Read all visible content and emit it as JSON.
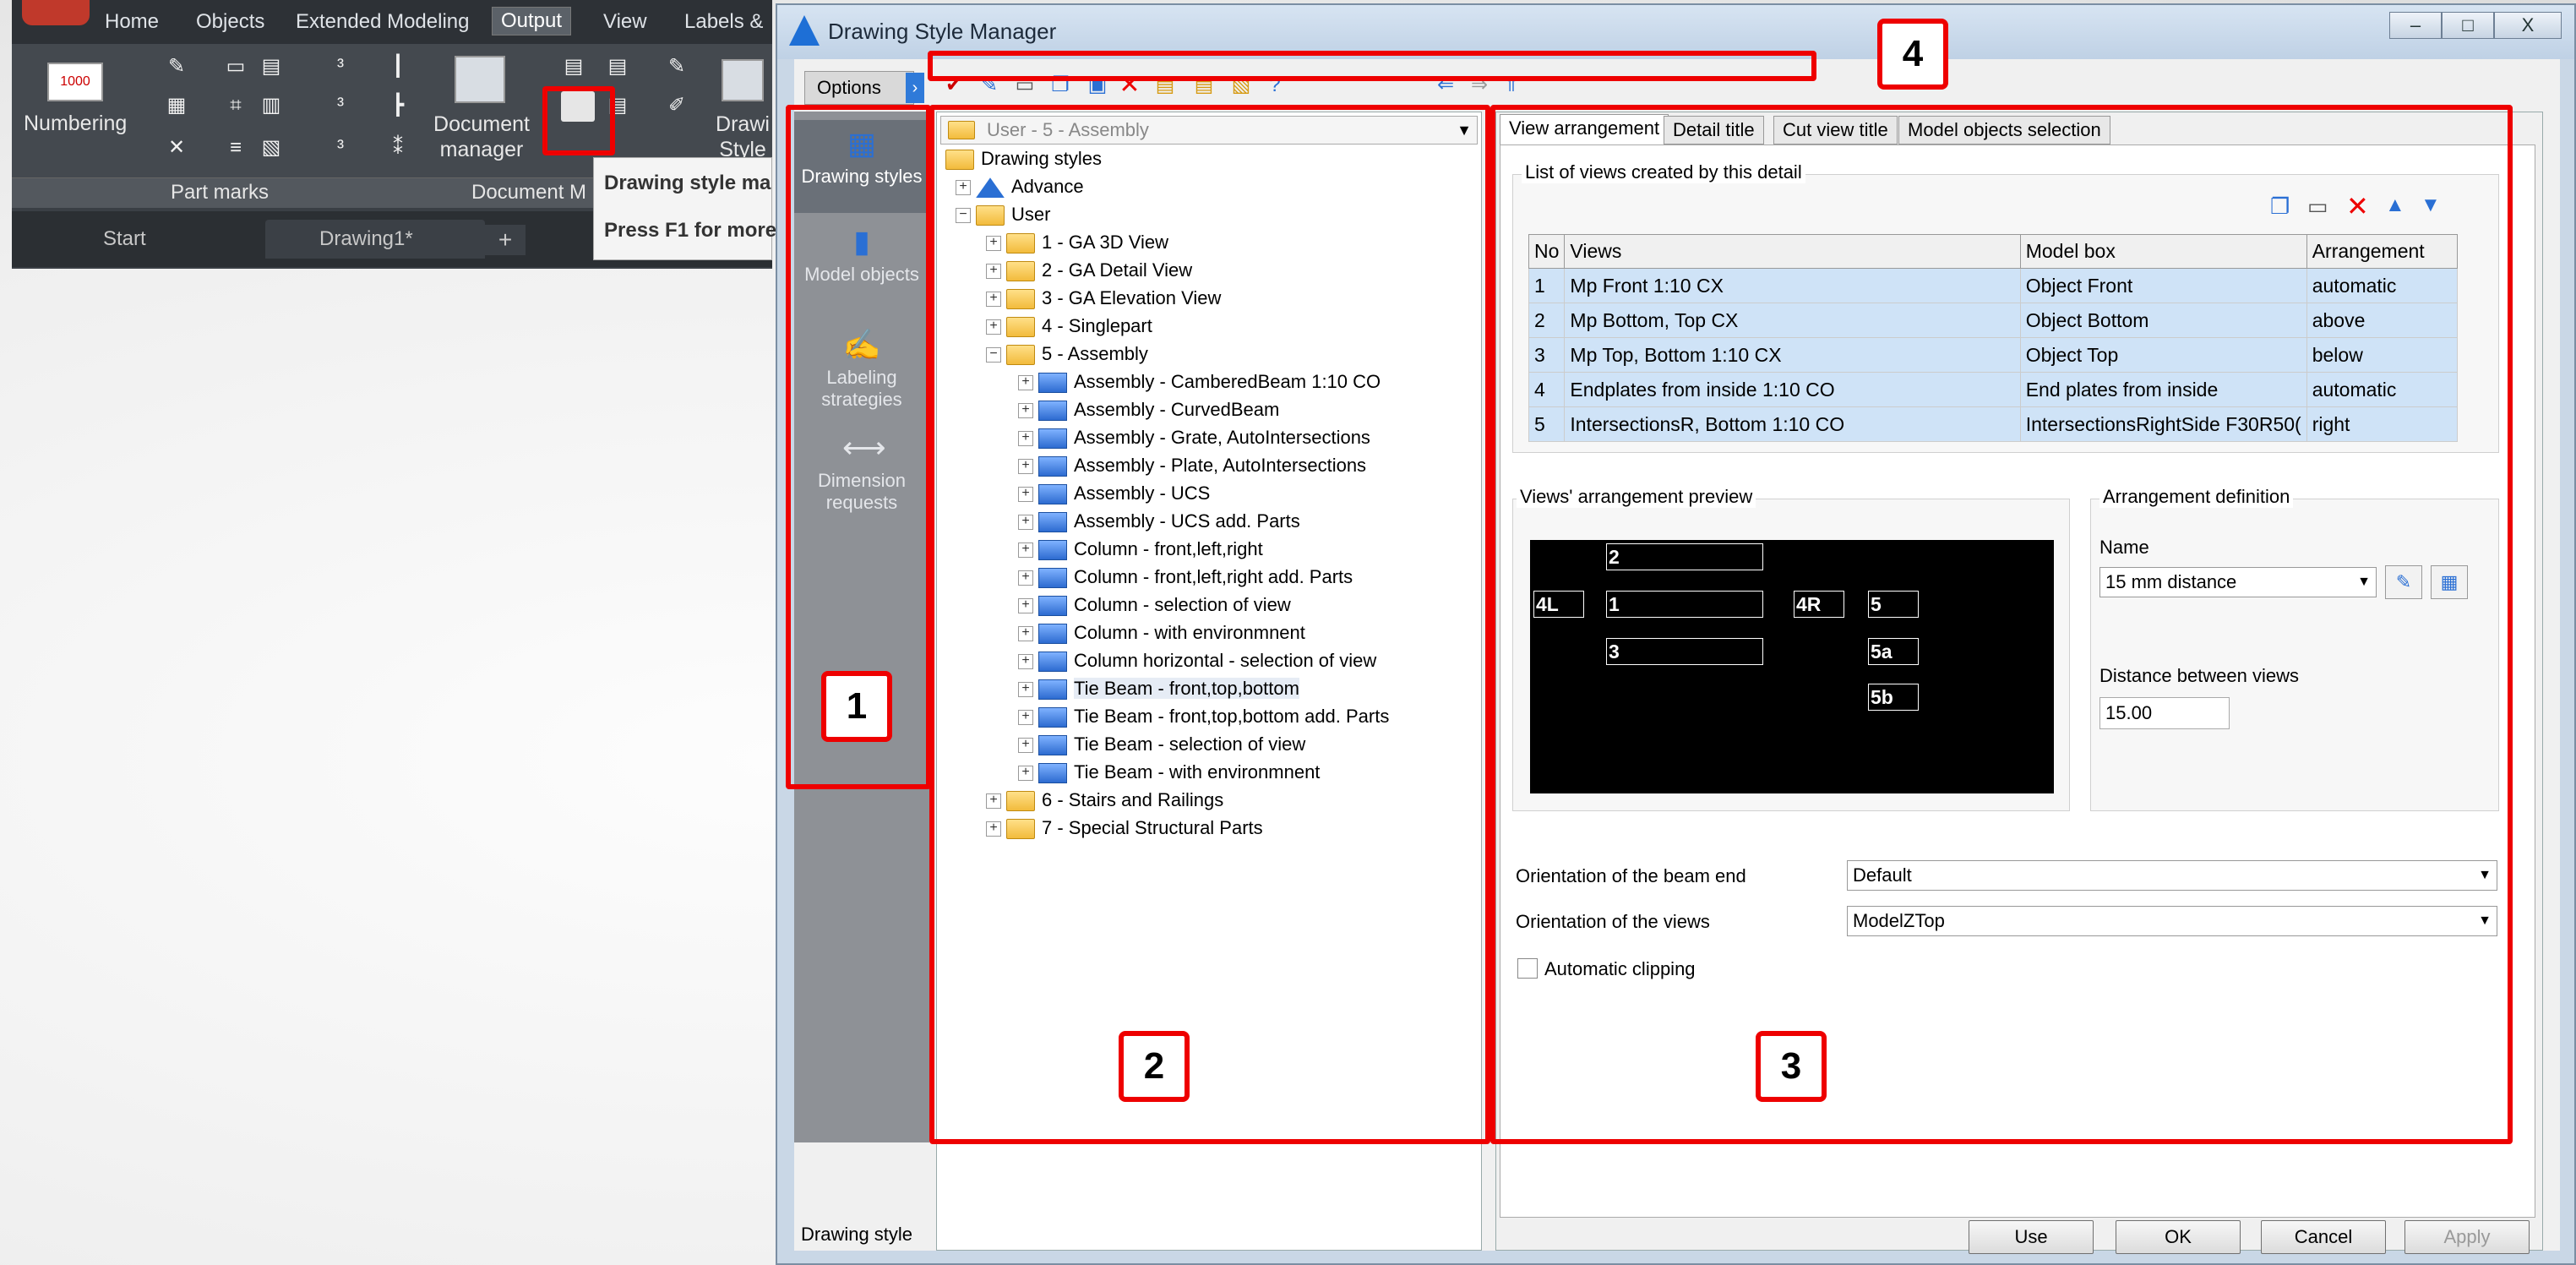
{
  "ribbon": {
    "tabs": [
      "Home",
      "Objects",
      "Extended Modeling",
      "Output",
      "View",
      "Labels &"
    ],
    "active_tab": "Output",
    "numbering_label": "Numbering",
    "doc_manager_label": "Document manager",
    "drawing_styles_label": "Drawi Style",
    "part_marks_panel": "Part marks",
    "doc_panel": "Document M",
    "doc_tabs": [
      "Start",
      "Drawing1*"
    ],
    "add_tab": "+",
    "tooltip_title": "Drawing style ma",
    "tooltip_help": "Press F1 for more"
  },
  "dialog": {
    "title": "Drawing Style Manager",
    "minimize": "–",
    "maximize": "□",
    "close": "X",
    "options_tab": "Options",
    "sidebar": [
      {
        "label": "Drawing styles",
        "icon": "drawing-styles-icon"
      },
      {
        "label": "Model objects",
        "icon": "model-objects-icon"
      },
      {
        "label": "Labeling strategies",
        "icon": "labeling-icon"
      },
      {
        "label": "Dimension requests",
        "icon": "dimension-icon"
      }
    ],
    "tree_combo": "User - 5 - Assembly",
    "tree": {
      "root": "Drawing styles",
      "advance": "Advance",
      "user": "User",
      "groups": [
        "1 - GA 3D View",
        "2 - GA Detail View",
        "3 - GA Elevation View",
        "4 - Singlepart",
        "5 - Assembly"
      ],
      "assembly_children": [
        "Assembly - CamberedBeam 1:10 CO",
        "Assembly - CurvedBeam",
        "Assembly - Grate, AutoIntersections",
        "Assembly - Plate, AutoIntersections",
        "Assembly - UCS",
        "Assembly - UCS add. Parts",
        "Column - front,left,right",
        "Column - front,left,right add. Parts",
        "Column - selection of view",
        "Column - with environmnent",
        "Column horizontal - selection of view",
        "Tie Beam - front,top,bottom",
        "Tie Beam - front,top,bottom add. Parts",
        "Tie Beam - selection of view",
        "Tie Beam - with environmnent"
      ],
      "tail_groups": [
        "6 - Stairs and Railings",
        "7 - Special Structural Parts"
      ]
    },
    "tabs": [
      "View arrangement",
      "Detail title",
      "Cut view title",
      "Model objects selection"
    ],
    "views_group": "List of views created by this detail",
    "table": {
      "headers": [
        "No",
        "Views",
        "Model box",
        "Arrangement"
      ],
      "rows": [
        [
          "1",
          "Mp Front 1:10 CX",
          "Object Front",
          "automatic"
        ],
        [
          "2",
          "Mp Bottom, Top CX",
          "Object Bottom",
          "above"
        ],
        [
          "3",
          "Mp Top, Bottom 1:10 CX",
          "Object Top",
          "below"
        ],
        [
          "4",
          "Endplates from inside 1:10 CO",
          "End plates from inside",
          "automatic"
        ],
        [
          "5",
          "IntersectionsR, Bottom 1:10 CO",
          "IntersectionsRightSide F30R50(",
          "right"
        ]
      ]
    },
    "preview_group": "Views' arrangement preview",
    "preview_boxes": [
      "2",
      "4L",
      "1",
      "4R",
      "5",
      "3",
      "5a",
      "5b"
    ],
    "arrangement_group": "Arrangement definition",
    "name_label": "Name",
    "name_value": "15 mm distance",
    "distance_label": "Distance between views",
    "distance_value": "15.00",
    "beam_end_label": "Orientation of the beam end",
    "beam_end_value": "Default",
    "views_orient_label": "Orientation of the views",
    "views_orient_value": "ModelZTop",
    "auto_clip_label": "Automatic clipping",
    "status": "Drawing style",
    "buttons": {
      "use": "Use",
      "ok": "OK",
      "cancel": "Cancel",
      "apply": "Apply"
    }
  },
  "annotations": [
    "1",
    "2",
    "3",
    "4"
  ],
  "colors": {
    "annotation": "#e00000",
    "selection": "#cfe3f7",
    "ribbon": "#3a3f45"
  }
}
